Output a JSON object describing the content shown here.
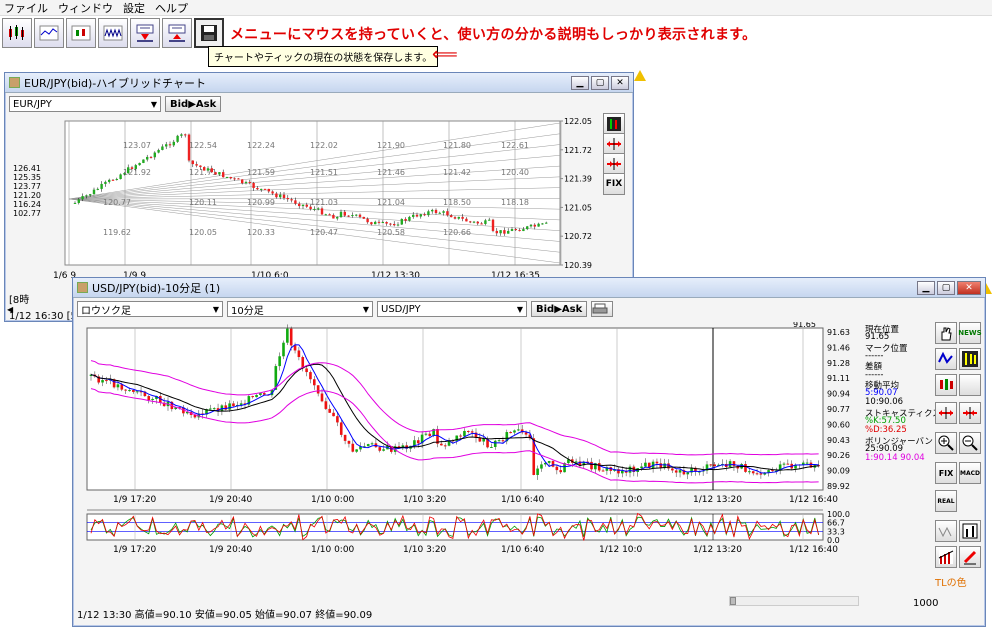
{
  "menu": {
    "file": "ファイル",
    "window": "ウィンドウ",
    "settings": "設定",
    "help": "ヘルプ"
  },
  "promo": "メニューにマウスを持っていくと、使い方の分かる説明もしっかり表示されます。",
  "tooltip": "チャートやティックの現在の状態を保存します。",
  "arrow": "⟸",
  "eur": {
    "title": "EUR/JPY(bid)-ハイブリッドチャート",
    "pair": "EUR/JPY",
    "bidask": "Bid▶Ask",
    "yticks": [
      "122.05",
      "121.72",
      "121.39",
      "121.05",
      "120.72",
      "120.39"
    ],
    "left_vals": [
      "126.41",
      "125.35",
      "123.77",
      "121.20",
      "116.24",
      "102.77"
    ],
    "grid_vals": [
      "123.07",
      "122.54",
      "122.24",
      "122.02",
      "121.90",
      "121.80",
      "122.61",
      "121.92",
      "121.71",
      "121.59",
      "121.51",
      "121.46",
      "121.42",
      "120.40",
      "120.77",
      "120.11",
      "120.99",
      "121.03",
      "121.04",
      "118.50",
      "118.18",
      "119.62",
      "120.05",
      "120.33",
      "120.47",
      "120.58",
      "120.66"
    ],
    "xticks": [
      "1/6 9",
      "1/9 9",
      "1/10 6:0",
      "1/12 13:30",
      "1/12 16:35"
    ],
    "partial": "[8時",
    "status": "1/12 16:30 [5分"
  },
  "usd": {
    "title": "USD/JPY(bid)-10分足 (1)",
    "type": "ロウソク足",
    "tf": "10分足",
    "pair": "USD/JPY",
    "bidask": "Bid▶Ask",
    "current_price": "91.65",
    "yticks": [
      "91.63",
      "91.46",
      "91.28",
      "91.11",
      "90.94",
      "90.77",
      "90.60",
      "90.43",
      "90.26",
      "90.09",
      "89.92"
    ],
    "xticks": [
      "1/9 17:20",
      "1/9 20:40",
      "1/10 0:00",
      "1/10 3:20",
      "1/10 6:40",
      "1/12 10:0",
      "1/12 13:20",
      "1/12 16:40"
    ],
    "stoch_ticks": [
      "100.0",
      "66.7",
      "33.3",
      "0.0"
    ],
    "info": [
      {
        "t": "現在位置",
        "c": "#000"
      },
      {
        "t": "91.65",
        "c": "#000"
      },
      {
        "t": "マーク位置",
        "c": "#000"
      },
      {
        "t": "------",
        "c": "#000"
      },
      {
        "t": "差額",
        "c": "#000"
      },
      {
        "t": "------",
        "c": "#000"
      },
      {
        "t": "移動平均",
        "c": "#000"
      },
      {
        "t": "5:90.07",
        "c": "#0000ff"
      },
      {
        "t": "10:90.06",
        "c": "#000"
      },
      {
        "t": "ストキャスティクス",
        "c": "#000"
      },
      {
        "t": "%K:57.50",
        "c": "#00a000"
      },
      {
        "t": "%D:36.25",
        "c": "#e00000"
      },
      {
        "t": "ボリンジャーバンド",
        "c": "#000"
      },
      {
        "t": "25:90.09",
        "c": "#000"
      },
      {
        "t": "1:90.14 90.04",
        "c": "#e000e0"
      }
    ],
    "tl_color": "TLの色",
    "status": "1/12 13:30  高値=90.10 安値=90.05 始値=90.07 終値=90.09",
    "zoom": "1000"
  }
}
